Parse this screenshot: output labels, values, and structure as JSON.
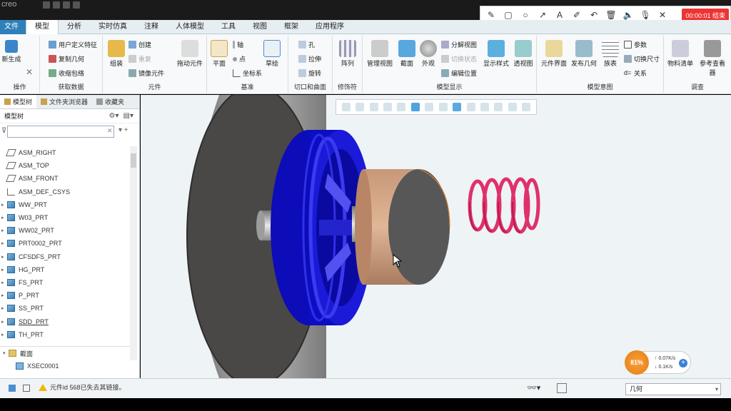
{
  "app": {
    "logo": "creo"
  },
  "recorder": {
    "timer": "00:00:01 结束"
  },
  "tabs": [
    "文件",
    "模型",
    "分析",
    "实时仿真",
    "注释",
    "人体模型",
    "工具",
    "视图",
    "框架",
    "应用程序"
  ],
  "ribbon": {
    "operation": {
      "new_component": "新生成",
      "label": "操作"
    },
    "get_data": {
      "user_feature": "用户定义特征",
      "copy_geometry": "复制几何",
      "shrinkwrap": "收缩包络",
      "label": "获取数据"
    },
    "component": {
      "assemble": "组装",
      "create": "创建",
      "repeat": "重复",
      "mirror": "镜像元件",
      "drag": "拖动元件",
      "label": "元件"
    },
    "datum": {
      "plane": "平面",
      "axis": "轴",
      "point": "点",
      "csys": "坐标系",
      "sketch": "草绘",
      "label": "基准"
    },
    "cut_surface": {
      "hole": "孔",
      "extrude": "拉伸",
      "revolve": "旋转",
      "label": "切口和曲面"
    },
    "modifiers": {
      "pattern": "阵列",
      "label": "修饰符"
    },
    "model_display": {
      "manage_views": "管理视图",
      "section": "截面",
      "appearance": "外观",
      "explode": "分解视图",
      "toggle_status": "切换状态",
      "edit_position": "编辑位置",
      "display_style": "显示样式",
      "perspective": "透视图",
      "label": "模型显示"
    },
    "model_intent": {
      "component_interface": "元件界面",
      "publish_geometry": "发布几何",
      "table": "族表",
      "parameters": "参数",
      "switch_dims": "切换尺寸",
      "relations": "关系",
      "label": "模型意图"
    },
    "investigate": {
      "bom": "物料清单",
      "reference_viewer": "参考查看器",
      "label": "调查"
    }
  },
  "panel": {
    "tabs": [
      "模型树",
      "文件夹浏览器",
      "收藏夹"
    ],
    "tree_title": "模型树",
    "filter_placeholder": "",
    "items": [
      {
        "label": "ASM_RIGHT",
        "icon": "plane-icon"
      },
      {
        "label": "ASM_TOP",
        "icon": "plane-icon"
      },
      {
        "label": "ASM_FRONT",
        "icon": "plane-icon"
      },
      {
        "label": "ASM_DEF_CSYS",
        "icon": "csys-icon"
      },
      {
        "label": "WW_PRT",
        "icon": "part-icon"
      },
      {
        "label": "W03_PRT",
        "icon": "part-icon"
      },
      {
        "label": "WW02_PRT",
        "icon": "part-icon"
      },
      {
        "label": "PRT0002_PRT",
        "icon": "part-icon"
      },
      {
        "label": "CFSDFS_PRT",
        "icon": "part-icon"
      },
      {
        "label": "HG_PRT",
        "icon": "part-icon"
      },
      {
        "label": "FS_PRT",
        "icon": "part-icon"
      },
      {
        "label": "P_PRT",
        "icon": "part-icon"
      },
      {
        "label": "SS_PRT",
        "icon": "part-icon"
      },
      {
        "label": "SDD_PRT",
        "icon": "part-icon"
      },
      {
        "label": "TH_PRT",
        "icon": "part-icon"
      }
    ],
    "sections_label": "截面",
    "section_item": "XSEC0001"
  },
  "status": {
    "message": "元件id 568已失去其链接。",
    "filter_value": "几何"
  },
  "netmon": {
    "percent": "81%",
    "up": "0.07K/s",
    "down": "0.1K/s"
  },
  "colors": {
    "accent": "#2f7fb9",
    "wheel": "#1212d6",
    "spring": "#e0306a",
    "cylinder": "#c99a78"
  }
}
